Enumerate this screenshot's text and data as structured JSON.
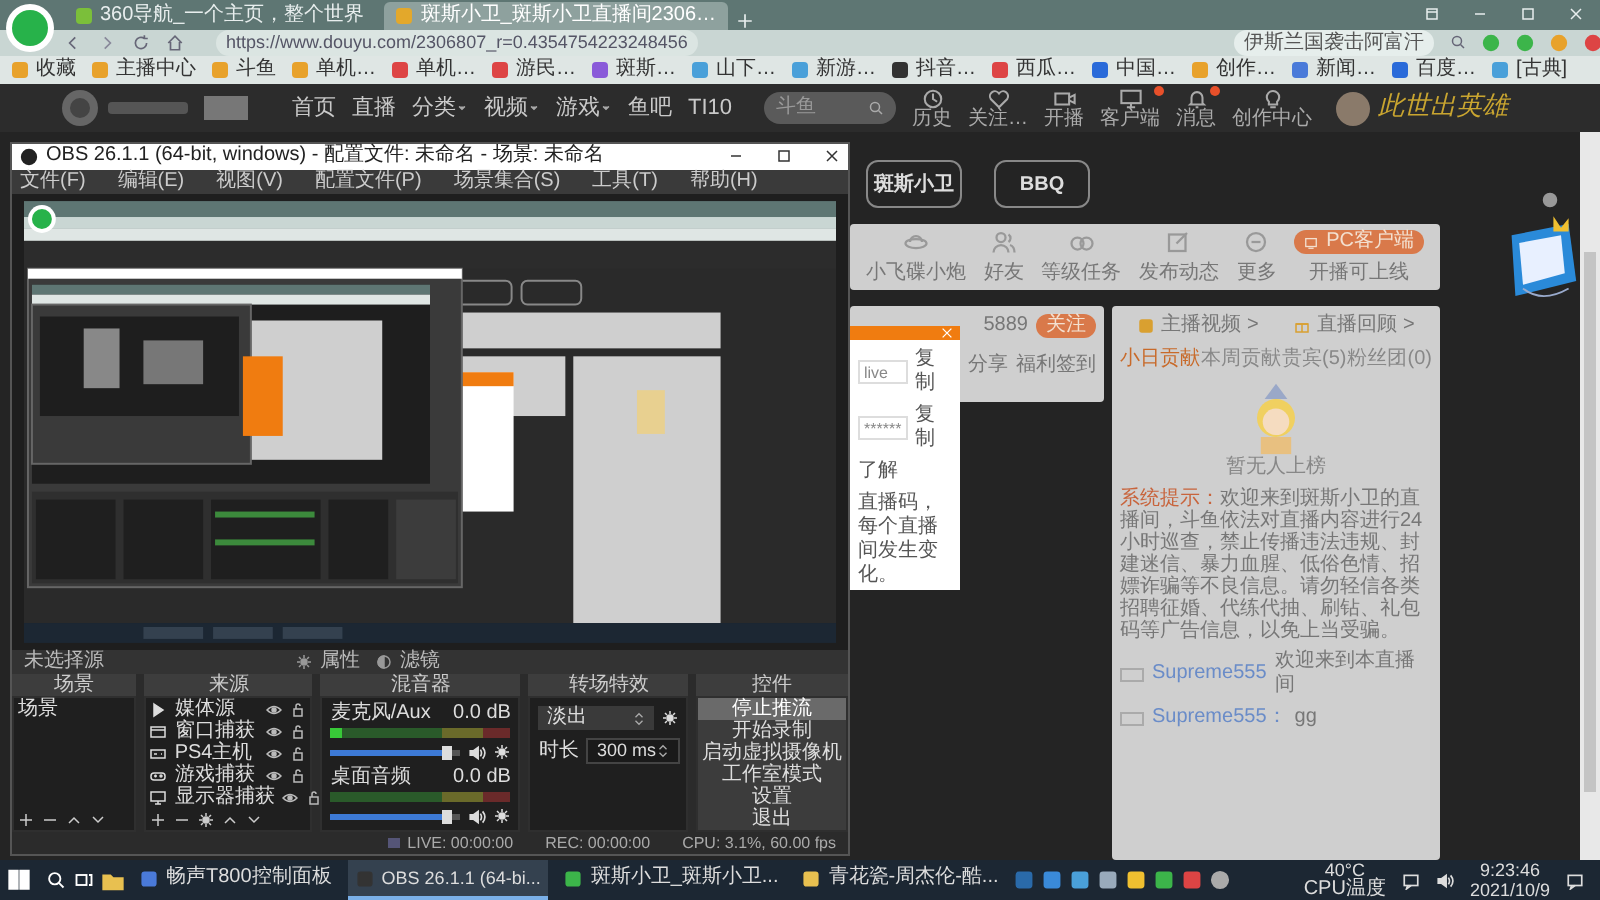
{
  "browser": {
    "tabs": [
      {
        "title": "360导航_一个主页，整个世界",
        "selected": false
      },
      {
        "title": "斑斯小卫_斑斯小卫直播间2306…",
        "selected": true
      }
    ],
    "url": "https://www.douyu.com/2306807_r=0.4354754223248456",
    "search": "伊斯兰国袭击阿富汗",
    "bookmarks": [
      "收藏",
      "主播中心",
      "斗鱼",
      "单机…",
      "单机…",
      "游民…",
      "斑斯…",
      "山下…",
      "新游…",
      "抖音…",
      "西瓜…",
      "中国…",
      "创作…",
      "新闻…",
      "百度…",
      "[古典]"
    ]
  },
  "site_header": {
    "nav": [
      {
        "label": "首页",
        "dropdown": false
      },
      {
        "label": "直播",
        "dropdown": false
      },
      {
        "label": "分类",
        "dropdown": true
      },
      {
        "label": "视频",
        "dropdown": true
      },
      {
        "label": "游戏",
        "dropdown": true
      },
      {
        "label": "鱼吧",
        "dropdown": false
      },
      {
        "label": "TI10",
        "dropdown": false
      }
    ],
    "search_placeholder": "斗鱼",
    "tools": [
      {
        "label": "历史",
        "badge": false
      },
      {
        "label": "关注…",
        "badge": false
      },
      {
        "label": "开播",
        "badge": false
      },
      {
        "label": "客户端",
        "badge": true
      },
      {
        "label": "消息",
        "badge": true
      },
      {
        "label": "创作中心",
        "badge": false
      }
    ],
    "slogan": "此世出英雄"
  },
  "obs": {
    "title": "OBS 26.1.1 (64-bit, windows) - 配置文件: 未命名 - 场景: 未命名",
    "menu": [
      "文件(F)",
      "编辑(E)",
      "视图(V)",
      "配置文件(P)",
      "场景集合(S)",
      "工具(T)",
      "帮助(H)"
    ],
    "source_bar": {
      "label": "未选择源",
      "buttons": [
        "属性",
        "滤镜"
      ]
    },
    "docks": [
      "场景",
      "来源",
      "混音器",
      "转场特效",
      "控件"
    ],
    "scenes": [
      {
        "name": "场景",
        "selected": false
      }
    ],
    "sources": [
      {
        "name": "媒体源",
        "kind": "media",
        "visible": true
      },
      {
        "name": "窗口捕获",
        "kind": "window",
        "visible": true
      },
      {
        "name": "PS4主机",
        "kind": "device",
        "visible": true
      },
      {
        "name": "游戏捕获",
        "kind": "game",
        "visible": true
      },
      {
        "name": "显示器捕获",
        "kind": "display",
        "visible": true
      }
    ],
    "mixer": [
      {
        "name": "麦克风/Aux",
        "reading": "0.0 dB",
        "signal": true,
        "level": 0.9,
        "muted": false
      },
      {
        "name": "桌面音频",
        "reading": "0.0 dB",
        "signal": false,
        "level": 0.9,
        "muted": false
      }
    ],
    "transition": {
      "effect": "淡出",
      "duration_label": "时长",
      "duration": "300 ms"
    },
    "controls": [
      {
        "label": "停止推流",
        "active": true
      },
      {
        "label": "开始录制",
        "active": false
      },
      {
        "label": "启动虚拟摄像机",
        "active": false
      },
      {
        "label": "工作室模式",
        "active": false
      },
      {
        "label": "设置",
        "active": false
      },
      {
        "label": "退出",
        "active": false
      }
    ],
    "status": {
      "live": "LIVE: 00:00:00",
      "rec": "REC: 00:00:00",
      "cpu": "CPU: 3.1%, 60.00 fps"
    }
  },
  "room": {
    "streamers": [
      "斑斯小卫",
      "BBQ"
    ],
    "toolbar": [
      "小飞碟小炮",
      "好友",
      "等级任务",
      "发布动态",
      "更多"
    ],
    "client_button": "PC客户端",
    "client_note": "开播可上线",
    "follow_count": "5889",
    "follow_button": "关注",
    "actions": [
      "分享",
      "福利签到"
    ],
    "dialog": {
      "fields": [
        {
          "value": "live",
          "button": "复制"
        },
        {
          "value": "******",
          "button": "复制"
        }
      ],
      "link": "了解",
      "text": "直播码，每个直播间发生变化。"
    },
    "ranking": {
      "links": [
        "主播视频 >",
        "直播回顾 >"
      ],
      "tabs": [
        {
          "label": "小日贡献",
          "selected": true
        },
        {
          "label": "本周贡献",
          "selected": false
        },
        {
          "label": "贵宾(5)",
          "selected": false
        },
        {
          "label": "粉丝团(0)",
          "selected": false
        }
      ],
      "empty": "暂无人上榜"
    },
    "system": {
      "label": "系统提示：",
      "text": "欢迎来到斑斯小卫的直播间，斗鱼依法对直播内容进行24小时巡查，禁止传播违法违规、封建迷信、暴力血腥、低俗色情、招嫖诈骗等不良信息。请勿轻信各类招聘征婚、代练代抽、刷钻、礼包码等广告信息，以免上当受骗。"
    },
    "chat": [
      {
        "user": "Supreme555",
        "text": "欢迎来到本直播间"
      },
      {
        "user": "Supreme555：",
        "text": "gg"
      }
    ]
  },
  "taskbar": {
    "apps": [
      {
        "label": "畅声T800控制面板",
        "active": false
      },
      {
        "label": "OBS 26.1.1 (64-bi...",
        "active": true
      },
      {
        "label": "斑斯小卫_斑斯小卫...",
        "active": false
      },
      {
        "label": "青花瓷-周杰伦-酷...",
        "active": false
      }
    ],
    "temperature": "40°C",
    "temperature_label": "CPU温度",
    "time": "9:23:46",
    "date": "2021/10/9"
  }
}
